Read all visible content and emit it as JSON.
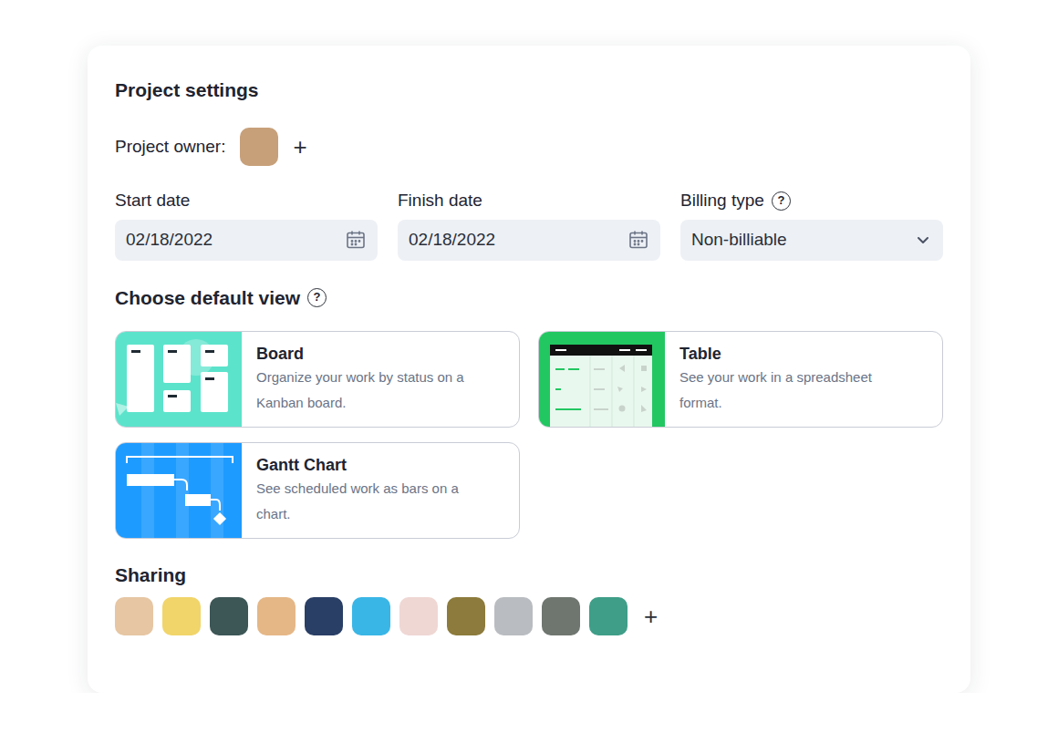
{
  "title": "Project settings",
  "owner": {
    "label": "Project owner:",
    "avatar_color": "#c7a07a",
    "add": "+"
  },
  "fields": [
    {
      "label": "Start date",
      "value": "02/18/2022",
      "kind": "date"
    },
    {
      "label": "Finish date",
      "value": "02/18/2022",
      "kind": "date"
    },
    {
      "label": "Billing type",
      "value": "Non-billiable",
      "kind": "select",
      "help": "?"
    }
  ],
  "default_view": {
    "title": "Choose default view",
    "help": "?",
    "options": [
      {
        "title": "Board",
        "description": "Organize your work by status on a Kanban board.",
        "kind": "board",
        "color": "#5ce3cb",
        "selected": false
      },
      {
        "title": "Table",
        "description": "See your work in a spreadsheet format.",
        "kind": "table",
        "color": "#22c761",
        "selected": false
      },
      {
        "title": "Gantt Chart",
        "description": "See scheduled work as bars on a chart.",
        "kind": "gantt",
        "color": "#1e9bff",
        "selected": false
      }
    ]
  },
  "sharing": {
    "title": "Sharing",
    "members": [
      {
        "color": "#e6c6a3"
      },
      {
        "color": "#f1d56a"
      },
      {
        "color": "#3d5656"
      },
      {
        "color": "#e5b787"
      },
      {
        "color": "#2a3f66"
      },
      {
        "color": "#39b6e6"
      },
      {
        "color": "#efd7d4"
      },
      {
        "color": "#8c7b3c"
      },
      {
        "color": "#b9bcc0"
      },
      {
        "color": "#6f7670"
      },
      {
        "color": "#3f9e88"
      }
    ],
    "add": "+"
  }
}
